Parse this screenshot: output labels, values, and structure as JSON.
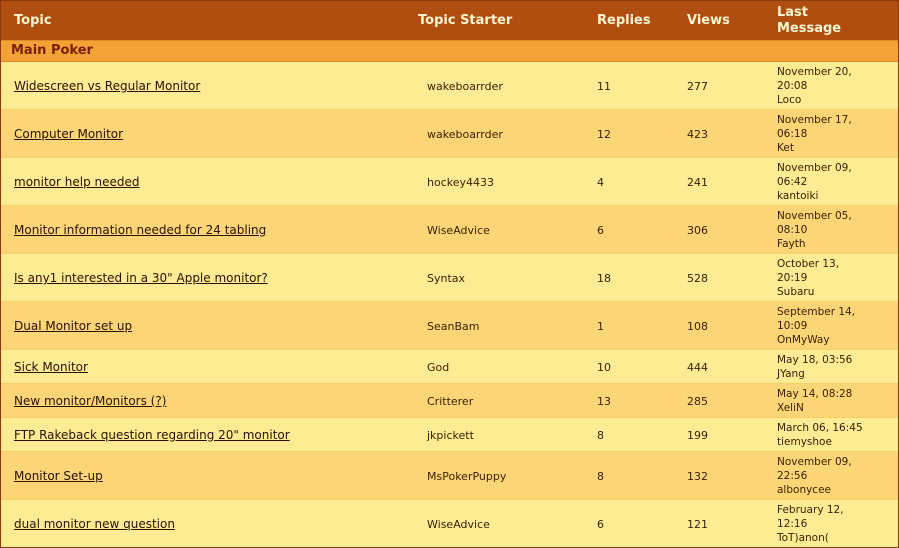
{
  "headers": {
    "topic": "Topic",
    "starter": "Topic Starter",
    "replies": "Replies",
    "views": "Views",
    "last_line1": "Last",
    "last_line2": "Message"
  },
  "section": {
    "title": "Main Poker"
  },
  "rows": [
    {
      "topic": "Widescreen vs Regular Monitor",
      "starter": "wakeboarrder",
      "replies": "11",
      "views": "277",
      "last_date1": "November 20,",
      "last_date2": "20:08",
      "last_user": "Loco"
    },
    {
      "topic": "Computer Monitor",
      "starter": "wakeboarrder",
      "replies": "12",
      "views": "423",
      "last_date1": "November 17,",
      "last_date2": "06:18",
      "last_user": "Ket"
    },
    {
      "topic": "monitor help needed",
      "starter": "hockey4433",
      "replies": "4",
      "views": "241",
      "last_date1": "November 09,",
      "last_date2": "06:42",
      "last_user": "kantoiki"
    },
    {
      "topic": "Monitor information needed for 24 tabling",
      "starter": "WiseAdvice",
      "replies": "6",
      "views": "306",
      "last_date1": "November 05,",
      "last_date2": "08:10",
      "last_user": "Fayth"
    },
    {
      "topic": "Is any1 interested in a 30\" Apple monitor?",
      "starter": "Syntax",
      "replies": "18",
      "views": "528",
      "last_date1": "October 13,",
      "last_date2": "20:19",
      "last_user": "Subaru"
    },
    {
      "topic": "Dual Monitor set up",
      "starter": "SeanBam",
      "replies": "1",
      "views": "108",
      "last_date1": "September 14,",
      "last_date2": "10:09",
      "last_user": "OnMyWay"
    },
    {
      "topic": "Sick Monitor",
      "starter": "God",
      "replies": "10",
      "views": "444",
      "last_date1": "May 18, 03:56",
      "last_date2": "",
      "last_user": "JYang"
    },
    {
      "topic": "New monitor/Monitors (?)",
      "starter": "Critterer",
      "replies": "13",
      "views": "285",
      "last_date1": "May 14, 08:28",
      "last_date2": "",
      "last_user": "XeliN"
    },
    {
      "topic": "FTP Rakeback question regarding 20\" monitor",
      "starter": "jkpickett",
      "replies": "8",
      "views": "199",
      "last_date1": "March 06, 16:45",
      "last_date2": "",
      "last_user": "tiemyshoe"
    },
    {
      "topic": "Monitor Set-up",
      "starter": "MsPokerPuppy",
      "replies": "8",
      "views": "132",
      "last_date1": "November 09,",
      "last_date2": "22:56",
      "last_user": "albonycee"
    },
    {
      "topic": "dual monitor new question",
      "starter": "WiseAdvice",
      "replies": "6",
      "views": "121",
      "last_date1": "February 12,",
      "last_date2": "12:16",
      "last_user": "ToT)anon("
    }
  ]
}
